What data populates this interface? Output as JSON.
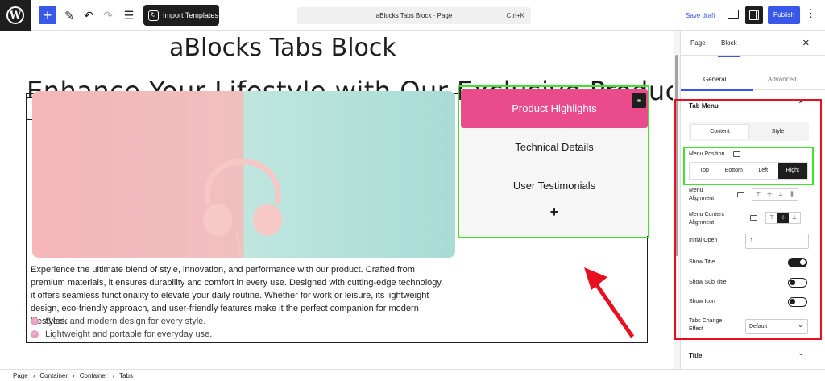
{
  "topbar": {
    "import_templates": "Import Templates",
    "doc_title": "aBlocks Tabs Block · Page",
    "shortcut": "Ctrl+K",
    "save_draft": "Save draft",
    "publish": "Publish"
  },
  "canvas": {
    "heading": "aBlocks Tabs Block",
    "subheading": "Enhance Your Lifestyle with Our Exclusive Products",
    "tabs": [
      "Product Highlights",
      "Technical Details",
      "User Testimonials"
    ],
    "add_tab": "+",
    "description": "Experience the ultimate blend of style, innovation, and performance with our product. Crafted from premium materials, it ensures durability and comfort in every use. Designed with cutting-edge technology, it offers seamless functionality to elevate your daily routine. Whether for work or leisure, its lightweight design, eco-friendly approach, and user-friendly features make it the perfect companion for modern lifestyles.",
    "bullets": [
      "Sleek and modern design for every style.",
      "Lightweight and portable for everyday use."
    ]
  },
  "breadcrumb": [
    "Page",
    "Container",
    "Container",
    "Tabs"
  ],
  "panel": {
    "tabs": [
      "Page",
      "Block"
    ],
    "subtabs": [
      "General",
      "Advanced"
    ],
    "section": "Tab Menu",
    "seg": [
      "Content",
      "Style"
    ],
    "menu_position_label": "Menu Position",
    "positions": [
      "Top",
      "Bottom",
      "Left",
      "Right"
    ],
    "menu_alignment_label": "Menu Alignment",
    "menu_content_alignment_label": "Menu Content Alignment",
    "initial_open_label": "Initial Open",
    "initial_open_value": "1",
    "show_title_label": "Show Title",
    "show_sub_title_label": "Show Sub Title",
    "show_icon_label": "Show Icon",
    "tabs_change_effect_label": "Tabs Change Effect",
    "tabs_change_effect_value": "Default",
    "title_section": "Title"
  }
}
